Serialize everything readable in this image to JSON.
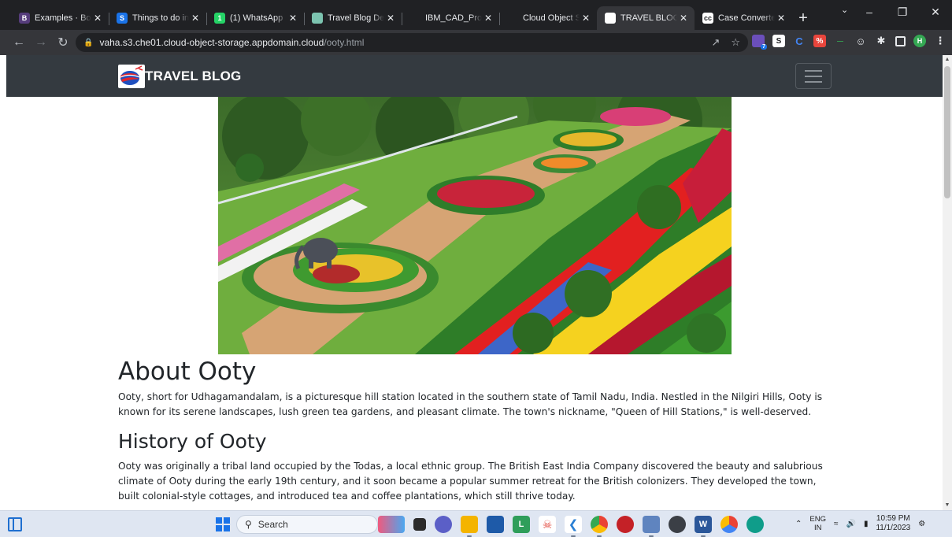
{
  "browser": {
    "tabs": [
      {
        "title": "Examples · Boo",
        "favicon": "B",
        "color": "#563d7c",
        "active": false
      },
      {
        "title": "Things to do in",
        "favicon": "S",
        "color": "#1a73e8",
        "active": false
      },
      {
        "title": "(1) WhatsApp",
        "favicon": "1",
        "color": "#25d366",
        "active": false
      },
      {
        "title": "Travel Blog Dev",
        "favicon": "",
        "color": "#7cc4b0",
        "active": false
      },
      {
        "title": "IBM_CAD_Proje",
        "favicon": "",
        "color": "#202124",
        "active": false
      },
      {
        "title": "Cloud Object St",
        "favicon": "",
        "color": "#202124",
        "active": false
      },
      {
        "title": "TRAVEL BLOG",
        "favicon": "",
        "color": "#ffffff",
        "active": true
      },
      {
        "title": "Case Converter",
        "favicon": "cc",
        "color": "#ffffff",
        "active": false
      }
    ],
    "address": {
      "host": "vaha.s3.che01.cloud-object-storage.appdomain.cloud",
      "path": "/ooty.html"
    },
    "profile_initial": "H",
    "extension_badge": "7",
    "extension_s_label": "S",
    "extension_c_label": "C"
  },
  "page": {
    "brand": "TRAVEL BLOG",
    "sections": {
      "about_title": "About Ooty",
      "about_text": "Ooty, short for Udhagamandalam, is a picturesque hill station located in the southern state of Tamil Nadu, India. Nestled in the Nilgiri Hills, Ooty is known for its serene landscapes, lush green tea gardens, and pleasant climate. The town's nickname, \"Queen of Hill Stations,\" is well-deserved.",
      "history_title": "History of Ooty",
      "history_text": "Ooty was originally a tribal land occupied by the Todas, a local ethnic group. The British East India Company discovered the beauty and salubrious climate of Ooty during the early 19th century, and it soon became a popular summer retreat for the British colonizers. They developed the town, built colonial-style cottages, and introduced tea and coffee plantations, which still thrive today."
    }
  },
  "taskbar": {
    "search_placeholder": "Search",
    "lang_top": "ENG",
    "lang_bottom": "IN",
    "time": "10:59 PM",
    "date": "11/1/2023"
  }
}
